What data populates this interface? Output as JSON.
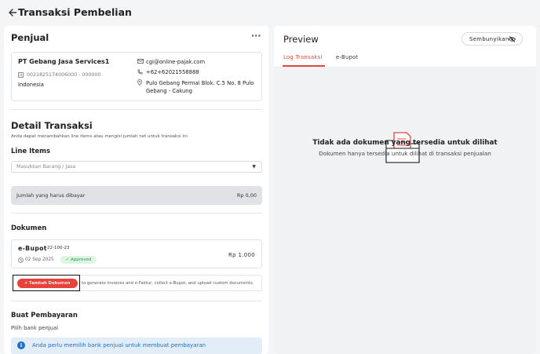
{
  "header": {
    "title": "Transaksi Pembelian",
    "back_icon": "arrow-left-icon"
  },
  "seller": {
    "heading": "Penjual",
    "company": "PT Gebang Jasa Services1",
    "npwp": "0021825174006000 - 000000",
    "country": "Indonesia",
    "email": "cgi@online-pajak.com",
    "phone": "+62+62021558888",
    "address_line1": "Pulo Gebang Permai Blok. C.5 No. 8 Pulo",
    "address_line2": "Gebang - Cakung",
    "more_icon": "more-horizontal-icon"
  },
  "detail": {
    "heading": "Detail Transaksi",
    "description": "Anda dapat menambahkan line items atau mengisi jumlah net untuk transaksi ini",
    "line_items_heading": "Line Items",
    "item_placeholder": "Masukkan Barang / Jasa",
    "total_label": "Jumlah yang harus dibayar",
    "total_value": "Rp 0,00"
  },
  "documents": {
    "heading": "Dokumen",
    "items": [
      {
        "name": "e-Bupot",
        "code": "22-100-23",
        "date": "02 Sep 2025",
        "status": "Approved",
        "amount": "Rp 1.000"
      }
    ],
    "add_button_label": "+ Tambah Dokumen",
    "add_help": "to generate invoices and e-Faktur, collect e-Bupot, and upload custom documents."
  },
  "payment": {
    "heading": "Buat Pembayaran",
    "bank_label": "Pilih bank penjual",
    "info": "Anda perlu memilih bank penjual untuk membuat pembayaran"
  },
  "preview": {
    "heading": "Preview",
    "hide_button_label": "Sembunyikan",
    "tabs": [
      {
        "label": "Log Transaksi",
        "active": true
      },
      {
        "label": "e-Bupot",
        "active": false
      }
    ],
    "empty_title": "Tidak ada dokumen yang tersedia untuk dilihat",
    "empty_subtitle": "Dokumen hanya tersedia untuk dilihat di transaksi penjualan"
  },
  "colors": {
    "accent": "#e2463c",
    "button": "#e9413b",
    "info": "#1e6fc8",
    "success": "#2e9a4a"
  }
}
